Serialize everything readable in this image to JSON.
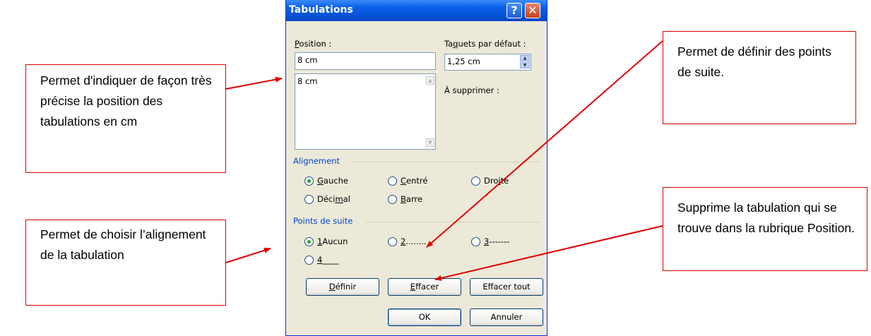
{
  "callouts": {
    "position_help": "Permet d'indiquer de façon très précise la position des tabulations en cm",
    "alignment_help": "Permet de choisir l’alignement de la tabulation",
    "leader_help": "Permet de définir des points de suite.",
    "clear_help": "Supprime la tabulation qui se trouve dans la rubrique Position."
  },
  "dialog": {
    "title": "Tabulations",
    "help_glyph": "?",
    "close_glyph": "✕",
    "position": {
      "label_first": "P",
      "label_rest": "osition :",
      "value": "8 cm",
      "list_items": [
        "8 cm"
      ]
    },
    "default_stops": {
      "label_pre": "Ta",
      "label_u": "q",
      "label_post": "uets par défaut :",
      "value": "1,25 cm"
    },
    "to_clear_label": "À supprimer :",
    "alignment": {
      "title": "Alignement",
      "left": {
        "pre": "",
        "u": "G",
        "post": "auche",
        "selected": true
      },
      "center": {
        "pre": "",
        "u": "C",
        "post": "entré",
        "selected": false
      },
      "right": {
        "pre": "Dro",
        "u": "i",
        "post": "te",
        "selected": false
      },
      "decimal": {
        "pre": "Déci",
        "u": "m",
        "post": "al",
        "selected": false
      },
      "bar": {
        "pre": "",
        "u": "B",
        "post": "arre",
        "selected": false
      }
    },
    "leader": {
      "title": "Points de suite",
      "opt1": {
        "u": "1",
        "post": " Aucun",
        "selected": true
      },
      "opt2": {
        "u": "2",
        "post": " ........",
        "selected": false
      },
      "opt3": {
        "u": "3",
        "post": " -------",
        "selected": false
      },
      "opt4": {
        "u": "4",
        "post": " ____",
        "selected": false
      }
    },
    "buttons": {
      "set": {
        "u": "D",
        "post": "éfinir"
      },
      "clear": {
        "u": "E",
        "post": "ffacer"
      },
      "clear_all": "Effacer tout",
      "ok": "OK",
      "cancel": "Annuler"
    }
  },
  "colors": {
    "arrow": "#e00000",
    "title_bar": "#0654d6",
    "group_title": "#0046d5"
  }
}
